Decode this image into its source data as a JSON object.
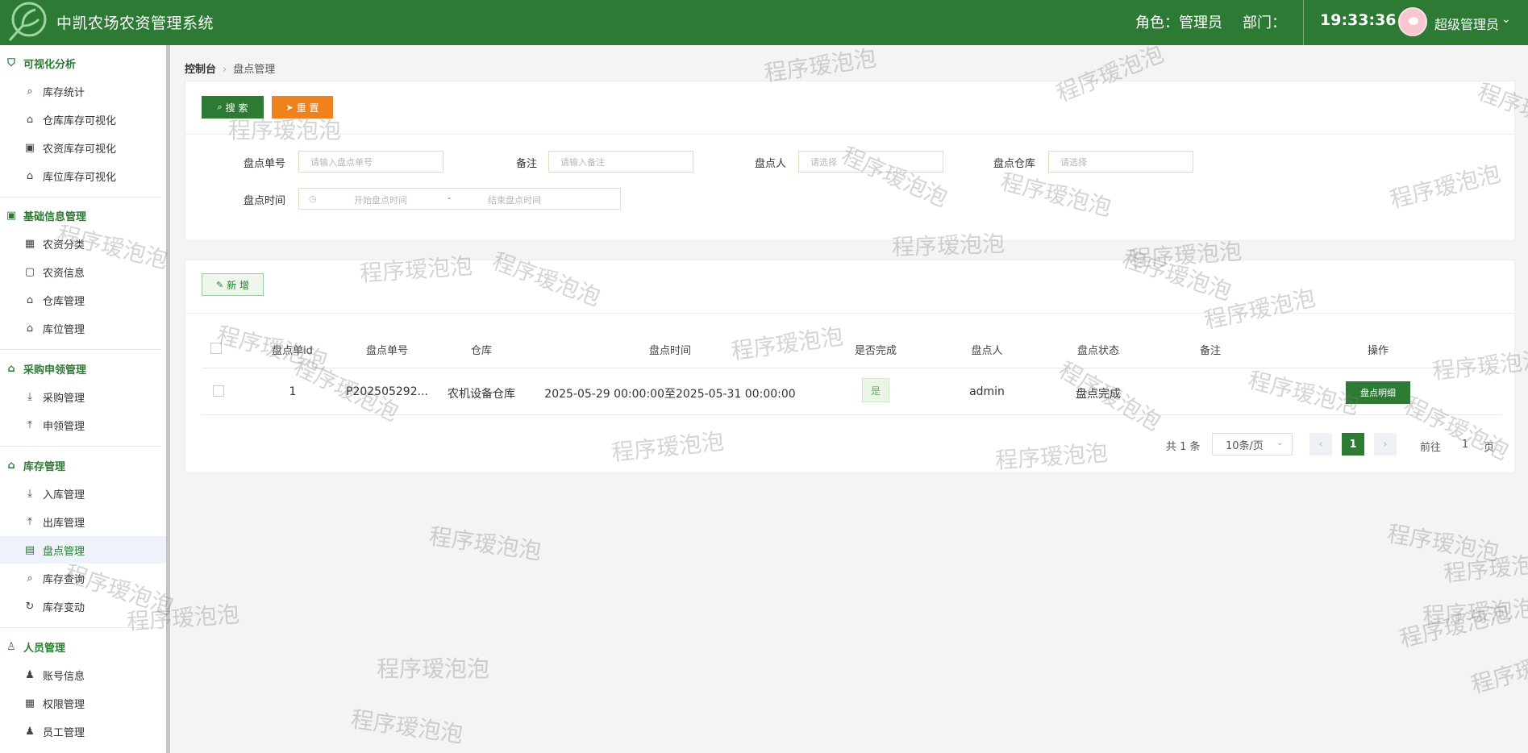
{
  "header": {
    "app_title": "中凯农场农资管理系统",
    "role": "角色：管理员",
    "dept": "部门：",
    "clock": "19:33:36",
    "username": "超级管理员",
    "accent_color": "#2d7a35"
  },
  "sidebar": {
    "groups": [
      {
        "title": "可视化分析",
        "icon": "chart-icon",
        "items": [
          {
            "label": "库存统计",
            "icon": "search-icon"
          },
          {
            "label": "仓库库存可视化",
            "icon": "home-icon"
          },
          {
            "label": "农资库存可视化",
            "icon": "bag-icon"
          },
          {
            "label": "库位库存可视化",
            "icon": "home-icon"
          }
        ]
      },
      {
        "title": "基础信息管理",
        "icon": "bag-icon",
        "items": [
          {
            "label": "农资分类",
            "icon": "grid-icon"
          },
          {
            "label": "农资信息",
            "icon": "bag-outline-icon"
          },
          {
            "label": "仓库管理",
            "icon": "house-outline-icon"
          },
          {
            "label": "库位管理",
            "icon": "house-outline-icon"
          }
        ]
      },
      {
        "title": "采购申领管理",
        "icon": "home-icon",
        "items": [
          {
            "label": "采购管理",
            "icon": "download-icon"
          },
          {
            "label": "申领管理",
            "icon": "upload-icon"
          }
        ]
      },
      {
        "title": "库存管理",
        "icon": "home-icon",
        "items": [
          {
            "label": "入库管理",
            "icon": "download-icon"
          },
          {
            "label": "出库管理",
            "icon": "upload-icon"
          },
          {
            "label": "盘点管理",
            "icon": "document-icon"
          },
          {
            "label": "库存查询",
            "icon": "search-icon"
          },
          {
            "label": "库存变动",
            "icon": "refresh-icon"
          }
        ]
      },
      {
        "title": "人员管理",
        "icon": "user-icon",
        "items": [
          {
            "label": "账号信息",
            "icon": "user-icon"
          },
          {
            "label": "权限管理",
            "icon": "grid-icon"
          },
          {
            "label": "员工管理",
            "icon": "user-icon"
          }
        ]
      }
    ],
    "active_item": "盘点管理"
  },
  "breadcrumb": {
    "home": "控制台",
    "current": "盘点管理"
  },
  "search_panel": {
    "search_label": "搜 索",
    "reset_label": "重 置",
    "fields": {
      "order_no": {
        "label": "盘点单号",
        "placeholder": "请输入盘点单号"
      },
      "remark": {
        "label": "备注",
        "placeholder": "请输入备注"
      },
      "person": {
        "label": "盘点人",
        "placeholder": "请选择"
      },
      "warehouse": {
        "label": "盘点仓库",
        "placeholder": "请选择"
      },
      "time": {
        "label": "盘点时间",
        "start_placeholder": "开始盘点时间",
        "separator": "-",
        "end_placeholder": "结束盘点时间"
      }
    }
  },
  "table": {
    "add_label": "新 增",
    "headers": [
      "盘点单id",
      "盘点单号",
      "仓库",
      "盘点时间",
      "是否完成",
      "盘点人",
      "盘点状态",
      "备注",
      "操作"
    ],
    "rows": [
      {
        "id": "1",
        "order_no": "P202505292...",
        "warehouse": "农机设备仓库",
        "time": "2025-05-29 00:00:00至2025-05-31 00:00:00",
        "done": "是",
        "person": "admin",
        "status": "盘点完成",
        "remark": "",
        "action": "盘点明细"
      }
    ]
  },
  "pagination": {
    "total": "共 1 条",
    "page_size": "10条/页",
    "current_page": "1",
    "goto_label": "前往",
    "goto_value": "1",
    "page_suffix": "页"
  },
  "watermark_text": "程序瑷泡泡"
}
